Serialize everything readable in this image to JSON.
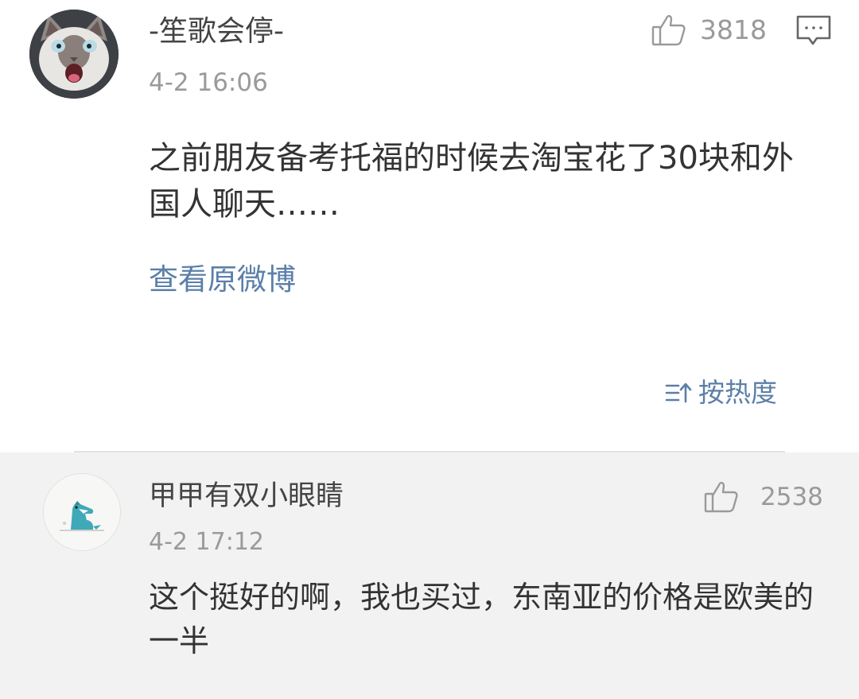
{
  "top_comment": {
    "username": "-笙歌会停-",
    "time": "4-2 16:06",
    "like_count": "3818",
    "content": "之前朋友备考托福的时候去淘宝花了30块和外国人聊天……",
    "view_original_label": "查看原微博",
    "sort_label": "按热度",
    "avatar_icon": "cat-avatar-icon",
    "like_icon": "thumbs-up-icon",
    "reply_icon": "comment-bubble-icon"
  },
  "reply_comment": {
    "username": "甲甲有双小眼睛",
    "time": "4-2 17:12",
    "like_count": "2538",
    "content": "这个挺好的啊，我也买过，东南亚的价格是欧美的一半",
    "avatar_icon": "dinosaur-avatar-icon",
    "like_icon": "thumbs-up-icon"
  },
  "colors": {
    "link_blue": "#5b7fa8",
    "meta_gray": "#9a9a9a",
    "reply_background": "#f2f2f2"
  }
}
